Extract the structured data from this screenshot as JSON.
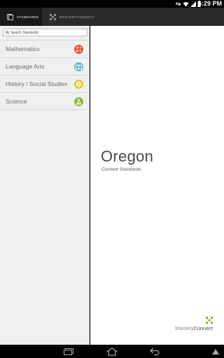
{
  "status_bar": {
    "time": "6:29 PM",
    "icons": [
      "usb-icon",
      "wifi-icon",
      "signal-icon",
      "battery-icon"
    ]
  },
  "tabs": [
    {
      "label": "STANDARDS",
      "icon": "standards-icon",
      "active": true
    },
    {
      "label": "MASTERYCONNECT",
      "icon": "mastery-connect-icon",
      "active": false
    }
  ],
  "sidebar": {
    "search_placeholder": "Search Standards",
    "subjects": [
      {
        "label": "Mathematics",
        "icon": "math-symbols-icon",
        "color": "#e0553a"
      },
      {
        "label": "Language Arts",
        "icon": "book-icon",
        "color": "#69b6bf"
      },
      {
        "label": "History / Social Studies",
        "icon": "globe-icon",
        "color": "#e5c52a"
      },
      {
        "label": "Science",
        "icon": "flask-icon",
        "color": "#8fb83b"
      }
    ]
  },
  "main": {
    "state": "Oregon",
    "subtitle": "Content Standards",
    "brand": {
      "part1": "Mastery",
      "part2": "Connect"
    }
  },
  "nav_bar": {
    "buttons": [
      "recent-apps-icon",
      "home-icon",
      "back-icon",
      "menu-icon"
    ]
  },
  "colors": {
    "tab_bar": "#2b2b2b",
    "sidebar_bg": "#efefef",
    "brand_green": "#7ab648"
  }
}
